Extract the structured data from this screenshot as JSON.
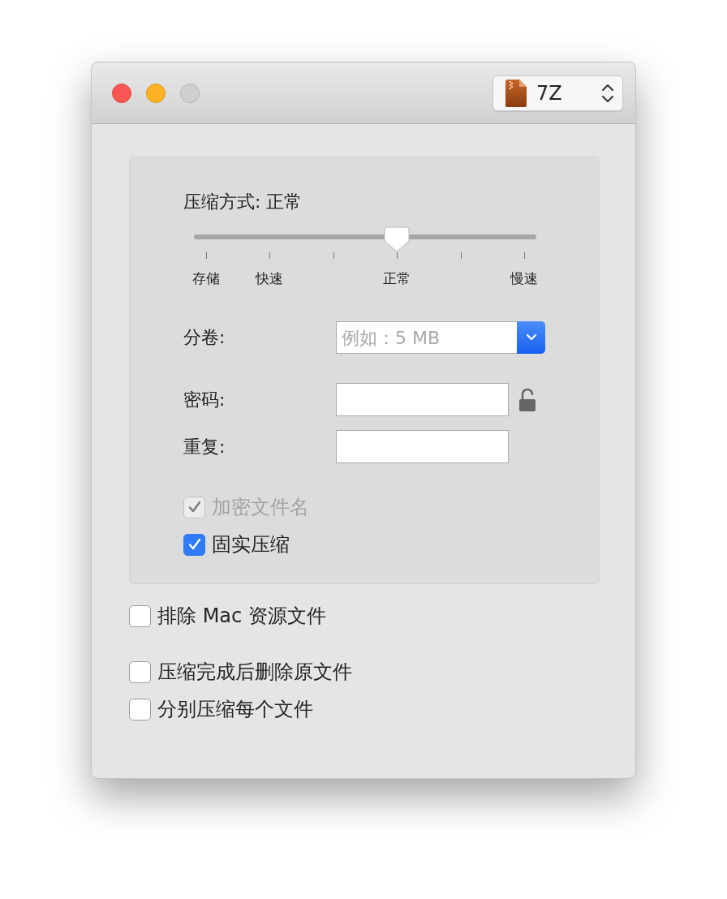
{
  "window": {
    "traffic_lights": [
      {
        "kind": "close",
        "disabled": false
      },
      {
        "kind": "minimize",
        "disabled": false
      },
      {
        "kind": "zoom",
        "disabled": true
      }
    ],
    "format_popup": {
      "value": "7Z"
    }
  },
  "compression": {
    "title": "压缩方式: 正常",
    "level": 0.6,
    "ticks": [
      {
        "kind": "labeled",
        "label": "存储"
      },
      {
        "kind": "labeled",
        "label": "快速"
      },
      {
        "kind": "plain"
      },
      {
        "kind": "labeled",
        "label": "正常"
      },
      {
        "kind": "plain"
      },
      {
        "kind": "labeled",
        "label": "慢速"
      }
    ]
  },
  "split": {
    "label": "分卷:",
    "placeholder": "例如：5 MB"
  },
  "password": {
    "label": "密码:",
    "locked": false
  },
  "repeat": {
    "label": "重复:"
  },
  "group_options": [
    {
      "label": "加密文件名",
      "checked": true,
      "disabled": true
    },
    {
      "label": "固实压缩",
      "checked": true,
      "disabled": false
    }
  ],
  "resource_options": [
    {
      "label": "排除 Mac 资源文件",
      "checked": false,
      "disabled": false
    }
  ],
  "after_options": [
    {
      "label": "压缩完成后删除原文件",
      "checked": false,
      "disabled": false
    },
    {
      "label": "分别压缩每个文件",
      "checked": false,
      "disabled": false
    }
  ]
}
